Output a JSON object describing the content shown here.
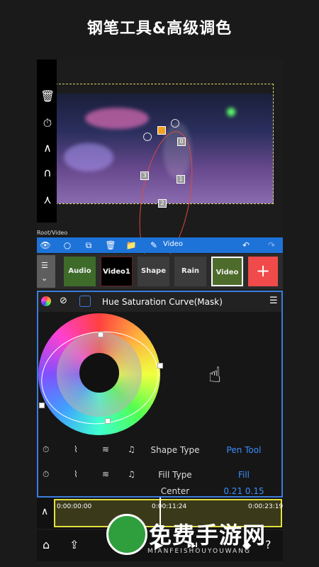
{
  "caption": "钢笔工具&高级调色",
  "breadcrumb": "Root/Video",
  "toolbar": {
    "label": "Video"
  },
  "layers": [
    {
      "label": "Audio",
      "color": "#3f6b2a"
    },
    {
      "label": "Video1",
      "color": "#6b1e1e"
    },
    {
      "label": "Shape",
      "color": "#3c3c3c"
    },
    {
      "label": "Rain",
      "color": "#3c3c3c"
    },
    {
      "label": "Video",
      "color": "#4d6b2a"
    }
  ],
  "mask_points": [
    "0",
    "1",
    "2",
    "3"
  ],
  "panel": {
    "title": "Hue Saturation Curve(Mask)"
  },
  "properties": [
    {
      "name": "Shape Type",
      "value": "Pen Tool"
    },
    {
      "name": "Fill Type",
      "value": "Fill"
    },
    {
      "name": "Center",
      "value": "0.21    0.15"
    }
  ],
  "timeline": {
    "start": "0:00:00:00",
    "current": "0:00:11:24",
    "end": "0:00:23:19"
  },
  "watermark": {
    "title": "免费手游网",
    "sub": "MIANFEISHOUYOUWANG"
  },
  "colors": {
    "accent": "#1e73d8",
    "value_text": "#3b8eff",
    "timeline_border": "#e3e042",
    "add_button": "#f04a4a"
  }
}
